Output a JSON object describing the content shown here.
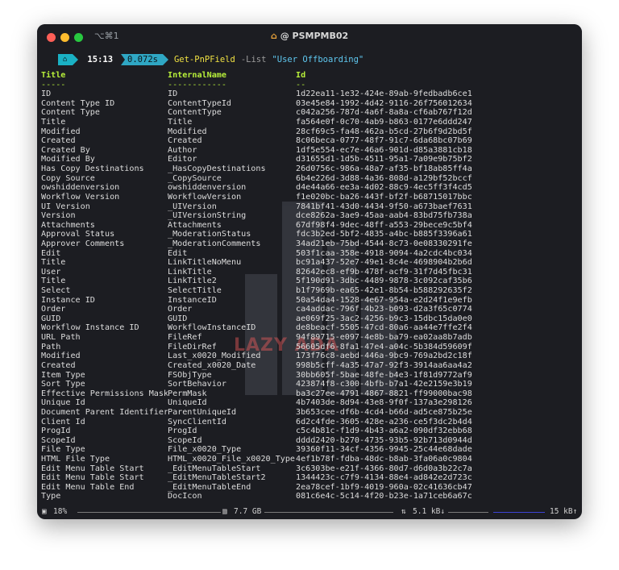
{
  "window": {
    "shortcut": "⌥⌘1",
    "title": "@ PSMPMB02",
    "title_icon": "house-icon"
  },
  "prompt": {
    "apple_icon": "apple-icon",
    "home_icon": "home-icon",
    "time": "15:13",
    "duration": "0.072s",
    "command": "Get-PnPField",
    "parameter": "-List",
    "argument": "\"User Offboarding\""
  },
  "table": {
    "headers": [
      "Title",
      "InternalName",
      "Id"
    ],
    "underlines": [
      "-----",
      "------------",
      "--"
    ],
    "rows": [
      [
        "ID",
        "ID",
        "1d22ea11-1e32-424e-89ab-9fedbadb6ce1"
      ],
      [
        "Content Type ID",
        "ContentTypeId",
        "03e45e84-1992-4d42-9116-26f756012634"
      ],
      [
        "Content Type",
        "ContentType",
        "c042a256-787d-4a6f-8a8a-cf6ab767f12d"
      ],
      [
        "Title",
        "Title",
        "fa564e0f-0c70-4ab9-b863-0177e6ddd247"
      ],
      [
        "Modified",
        "Modified",
        "28cf69c5-fa48-462a-b5cd-27b6f9d2bd5f"
      ],
      [
        "Created",
        "Created",
        "8c06beca-0777-48f7-91c7-6da68bc07b69"
      ],
      [
        "Created By",
        "Author",
        "1df5e554-ec7e-46a6-901d-d85a3881cb18"
      ],
      [
        "Modified By",
        "Editor",
        "d31655d1-1d5b-4511-95a1-7a09e9b75bf2"
      ],
      [
        "Has Copy Destinations",
        "_HasCopyDestinations",
        "26d0756c-986a-48a7-af35-bf18ab85ff4a"
      ],
      [
        "Copy Source",
        "_CopySource",
        "6b4e226d-3d88-4a36-808d-a129bf52bccf"
      ],
      [
        "owshiddenversion",
        "owshiddenversion",
        "d4e44a66-ee3a-4d02-88c9-4ec5ff3f4cd5"
      ],
      [
        "Workflow Version",
        "WorkflowVersion",
        "f1e020bc-ba26-443f-bf2f-b68715017bbc"
      ],
      [
        "UI Version",
        "_UIVersion",
        "7841bf41-43d0-4434-9f50-a673baef7631"
      ],
      [
        "Version",
        "_UIVersionString",
        "dce8262a-3ae9-45aa-aab4-83bd75fb738a"
      ],
      [
        "Attachments",
        "Attachments",
        "67df98f4-9dec-48ff-a553-29bece9c5bf4"
      ],
      [
        "Approval Status",
        "_ModerationStatus",
        "fdc3b2ed-5bf2-4835-a4bc-b885f3396a61"
      ],
      [
        "Approver Comments",
        "_ModerationComments",
        "34ad21eb-75bd-4544-8c73-0e08330291fe"
      ],
      [
        "Edit",
        "Edit",
        "503f1caa-358e-4918-9094-4a2cdc4bc034"
      ],
      [
        "Title",
        "LinkTitleNoMenu",
        "bc91a437-52e7-49e1-8c4e-4698904b2b6d"
      ],
      [
        "User",
        "LinkTitle",
        "82642ec8-ef9b-478f-acf9-31f7d45fbc31"
      ],
      [
        "Title",
        "LinkTitle2",
        "5f190d91-3dbc-4489-9878-3c092caf35b6"
      ],
      [
        "Select",
        "SelectTitle",
        "b1f7969b-ea65-42e1-8b54-b588292635f2"
      ],
      [
        "Instance ID",
        "InstanceID",
        "50a54da4-1528-4e67-954a-e2d24f1e9efb"
      ],
      [
        "Order",
        "Order",
        "ca4addac-796f-4b23-b093-d2a3f65c0774"
      ],
      [
        "GUID",
        "GUID",
        "ae069f25-3ac2-4256-b9c3-15dbc15da0e0"
      ],
      [
        "Workflow Instance ID",
        "WorkflowInstanceID",
        "de8beacf-5505-47cd-80a6-aa44e7ffe2f4"
      ],
      [
        "URL Path",
        "FileRef",
        "94f89715-e097-4e8b-ba79-ea02aa8b7adb"
      ],
      [
        "Path",
        "FileDirRef",
        "56605df6-8fa1-47e4-a04c-5b384d59609f"
      ],
      [
        "Modified",
        "Last_x0020_Modified",
        "173f76c8-aebd-446a-9bc9-769a2bd2c18f"
      ],
      [
        "Created",
        "Created_x0020_Date",
        "998b5cff-4a35-47a7-92f3-3914aa6aa4a2"
      ],
      [
        "Item Type",
        "FSObjType",
        "30bb605f-5bae-48fe-b4e3-1f81d9772af9"
      ],
      [
        "Sort Type",
        "SortBehavior",
        "423874f8-c300-4bfb-b7a1-42e2159e3b19"
      ],
      [
        "Effective Permissions Mask",
        "PermMask",
        "ba3c27ee-4791-4867-8821-ff99000bac98"
      ],
      [
        "Unique Id",
        "UniqueId",
        "4b7403de-8d94-43e8-9f0f-137a3e298126"
      ],
      [
        "Document Parent Identifier",
        "ParentUniqueId",
        "3b653cee-df6b-4cd4-b66d-ad5ce875b25e"
      ],
      [
        "Client Id",
        "SyncClientId",
        "6d2c4fde-3605-428e-a236-ce5f3dc2b4d4"
      ],
      [
        "ProgId",
        "ProgId",
        "c5c4b81c-f1d9-4b43-a6a2-090df32ebb68"
      ],
      [
        "ScopeId",
        "ScopeId",
        "dddd2420-b270-4735-93b5-92b713d0944d"
      ],
      [
        "File Type",
        "File_x0020_Type",
        "39360f11-34cf-4356-9945-25c44e68dade"
      ],
      [
        "HTML File Type",
        "HTML_x0020_File_x0020_Type",
        "4ef1b78f-fdba-48dc-b8ab-3fa06a0c9804"
      ],
      [
        "Edit Menu Table Start",
        "_EditMenuTableStart",
        "3c6303be-e21f-4366-80d7-d6d0a3b22c7a"
      ],
      [
        "Edit Menu Table Start",
        "_EditMenuTableStart2",
        "1344423c-c7f9-4134-88e4-ad842e2d723c"
      ],
      [
        "Edit Menu Table End",
        "_EditMenuTableEnd",
        "2ea78cef-1bf9-4019-960a-02c41636cb47"
      ],
      [
        "Type",
        "DocIcon",
        "081c6e4c-5c14-4f20-b23e-1a71ceb6a67c"
      ]
    ]
  },
  "watermark": {
    "text": "LAZY ADA"
  },
  "statusbar": {
    "cpu_icon": "cpu-icon",
    "cpu": "18%",
    "memory_icon": "memory-icon",
    "memory": "7.7 GB",
    "network_icon": "network-icon",
    "download": "5.1 kB↓",
    "upload": "15 kB↑",
    "colors": {
      "line": "#7a7a7a",
      "upload_line": "#3d44d6"
    }
  }
}
